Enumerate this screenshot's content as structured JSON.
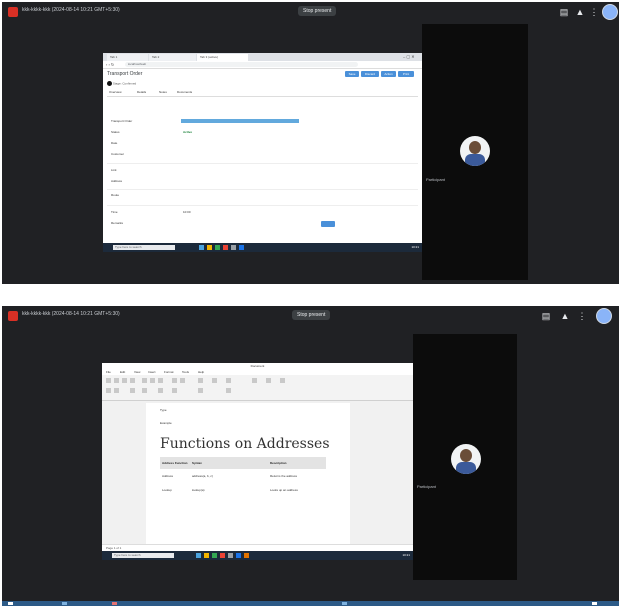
{
  "frames": [
    {
      "meeting_title": "kkk-kkkk-kkk (2024-08-14 10:21 GMT+5:30)",
      "present_label": "Stop present",
      "participant_name": "Participant"
    },
    {
      "meeting_title": "kkk-kkkk-kkk (2024-08-14 10:21 GMT+5:30)",
      "present_label": "Stop present",
      "participant_name": "Participant"
    }
  ],
  "browser": {
    "tabs": [
      "Tab 1",
      "Tab 2",
      "Tab 3 (active)"
    ],
    "url": "localhost/web",
    "page_title": "Transport Order",
    "actions": [
      "Save",
      "Discard",
      "Action",
      "Print"
    ],
    "meta": "Stage: Confirmed",
    "sub_tabs": [
      "Overview",
      "Details",
      "Notes",
      "Documents"
    ],
    "fields": [
      {
        "label": "Transport Order",
        "value": ""
      },
      {
        "label": "Status",
        "value": "Active"
      },
      {
        "label": "Date",
        "value": ""
      },
      {
        "label": "Customer",
        "value": ""
      },
      {
        "label": "Link",
        "value": ""
      },
      {
        "label": "Address",
        "value": ""
      },
      {
        "label": "Route",
        "value": ""
      },
      {
        "label": "Time",
        "value": "10:00"
      },
      {
        "label": "Remarks",
        "value": ""
      }
    ]
  },
  "doc": {
    "title": "Document",
    "menus": [
      "File",
      "Edit",
      "View",
      "Insert",
      "Format",
      "Tools",
      "Help"
    ],
    "heading": "Functions on Addresses",
    "header_rows": [
      {
        "col1": "Type",
        "col2": "",
        "col3": ""
      },
      {
        "col1": "Example",
        "col2": "",
        "col3": ""
      }
    ],
    "table": {
      "headers": [
        "Address Function",
        "Syntax",
        "Description"
      ],
      "rows": [
        {
          "function": "Address",
          "syntax": "address(a, b, c)",
          "description": "Returns the address"
        },
        {
          "function": "Lookup",
          "syntax": "lookup(a)",
          "description": "Looks up an address"
        }
      ]
    },
    "status": "Page 1 of 1"
  },
  "taskbar": {
    "search_placeholder": "Type here to search",
    "time": "10:21"
  }
}
